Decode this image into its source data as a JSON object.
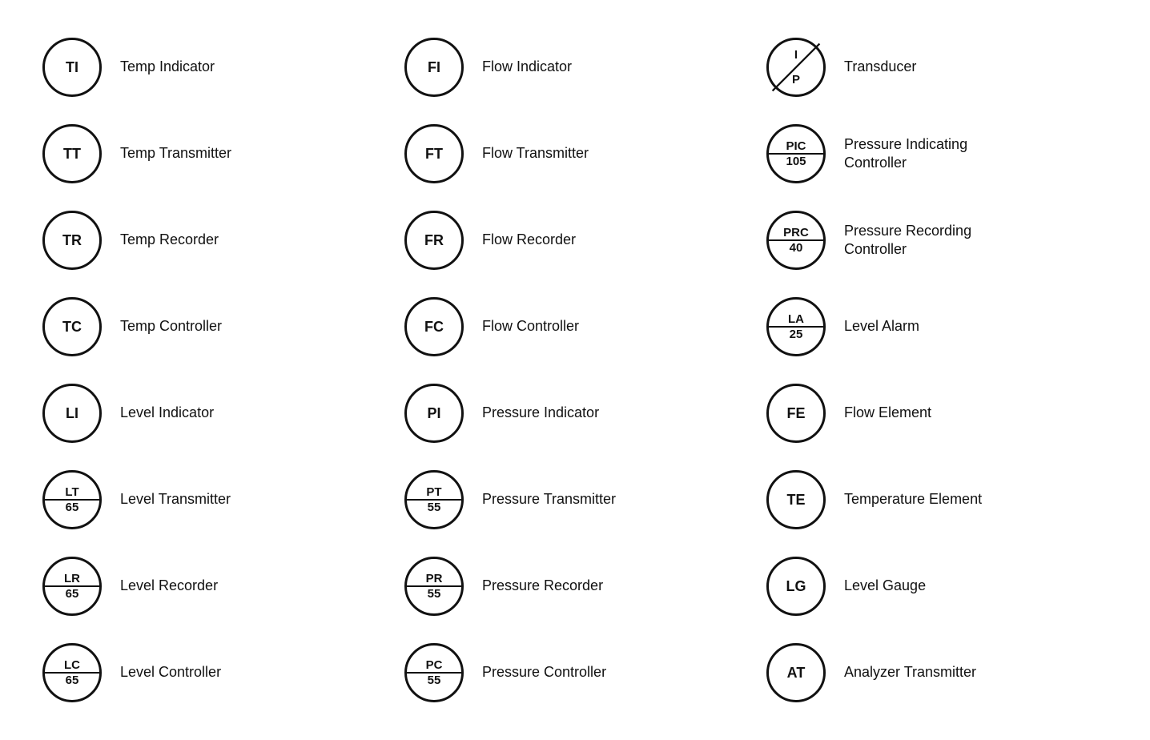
{
  "columns": [
    {
      "rows": [
        {
          "type": "circle",
          "code": "TI",
          "label": "Temp Indicator"
        },
        {
          "type": "circle",
          "code": "TT",
          "label": "Temp Transmitter"
        },
        {
          "type": "circle",
          "code": "TR",
          "label": "Temp Recorder"
        },
        {
          "type": "circle",
          "code": "TC",
          "label": "Temp Controller"
        },
        {
          "type": "circle",
          "code": "LI",
          "label": "Level Indicator"
        },
        {
          "type": "split",
          "top": "LT",
          "bottom": "65",
          "label": "Level Transmitter"
        },
        {
          "type": "split",
          "top": "LR",
          "bottom": "65",
          "label": "Level Recorder"
        },
        {
          "type": "split",
          "top": "LC",
          "bottom": "65",
          "label": "Level Controller"
        }
      ]
    },
    {
      "rows": [
        {
          "type": "circle",
          "code": "FI",
          "label": "Flow Indicator"
        },
        {
          "type": "circle",
          "code": "FT",
          "label": "Flow Transmitter"
        },
        {
          "type": "circle",
          "code": "FR",
          "label": "Flow Recorder"
        },
        {
          "type": "circle",
          "code": "FC",
          "label": "Flow Controller"
        },
        {
          "type": "circle",
          "code": "PI",
          "label": "Pressure Indicator"
        },
        {
          "type": "split",
          "top": "PT",
          "bottom": "55",
          "label": "Pressure Transmitter"
        },
        {
          "type": "split",
          "top": "PR",
          "bottom": "55",
          "label": "Pressure Recorder"
        },
        {
          "type": "split",
          "top": "PC",
          "bottom": "55",
          "label": "Pressure Controller"
        }
      ]
    },
    {
      "rows": [
        {
          "type": "diag",
          "top": "I",
          "bottom": "P",
          "label": "Transducer"
        },
        {
          "type": "split",
          "top": "PIC",
          "bottom": "105",
          "label": "Pressure Indicating\nController"
        },
        {
          "type": "split",
          "top": "PRC",
          "bottom": "40",
          "label": "Pressure Recording\nController"
        },
        {
          "type": "split",
          "top": "LA",
          "bottom": "25",
          "label": "Level Alarm"
        },
        {
          "type": "circle",
          "code": "FE",
          "label": "Flow Element"
        },
        {
          "type": "circle",
          "code": "TE",
          "label": "Temperature Element"
        },
        {
          "type": "circle",
          "code": "LG",
          "label": "Level Gauge"
        },
        {
          "type": "circle",
          "code": "AT",
          "label": "Analyzer Transmitter"
        }
      ]
    }
  ]
}
